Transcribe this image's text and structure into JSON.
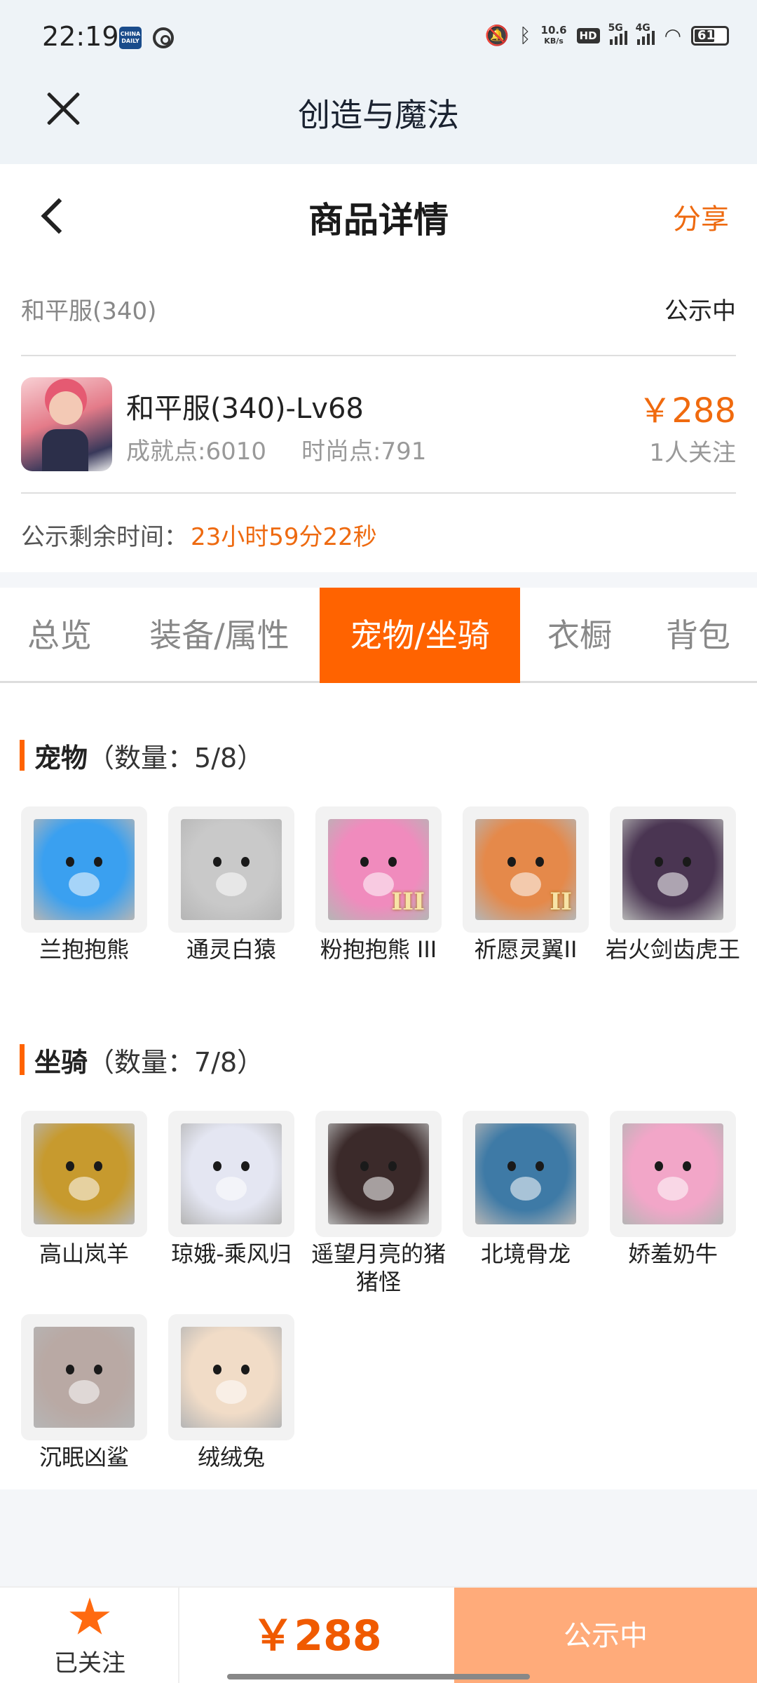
{
  "status_bar": {
    "time": "22:19",
    "speed_top": "10.6",
    "speed_unit": "KB/s",
    "hd_label": "HD",
    "net1": "5G",
    "net2": "4G",
    "battery": "61"
  },
  "app_header": {
    "title": "创造与魔法"
  },
  "nav": {
    "title": "商品详情",
    "share_label": "分享"
  },
  "listing": {
    "server": "和平服(340)",
    "status": "公示中",
    "character_name": "和平服(340)-Lv68",
    "achievement": "成就点:6010",
    "fashion": "时尚点:791",
    "price": "￥288",
    "followers": "1人关注",
    "remaining_label": "公示剩余时间：",
    "remaining_value": "23小时59分22秒"
  },
  "tabs": [
    {
      "label": "总览",
      "active": false
    },
    {
      "label": "装备/属性",
      "active": false
    },
    {
      "label": "宠物/坐骑",
      "active": true
    },
    {
      "label": "衣橱",
      "active": false
    },
    {
      "label": "背包",
      "active": false
    }
  ],
  "pets": {
    "title": "宠物",
    "count": "（数量：5/8）",
    "items": [
      {
        "name": "兰抱抱熊",
        "icon": "blue-bear-pet-icon",
        "color": "#3aa0f0"
      },
      {
        "name": "通灵白猿",
        "icon": "white-ape-pet-icon",
        "color": "#c9c9c9"
      },
      {
        "name": "粉抱抱熊 III",
        "icon": "pink-bear-pet-icon",
        "color": "#f08bbd",
        "badge": "III"
      },
      {
        "name": "祈愿灵翼II",
        "icon": "eagle-pet-icon",
        "color": "#e5894a",
        "badge": "II"
      },
      {
        "name": "岩火剑齿虎王",
        "icon": "sabertooth-pet-icon",
        "color": "#4a3552"
      }
    ]
  },
  "mounts": {
    "title": "坐骑",
    "count": "（数量：7/8）",
    "items": [
      {
        "name": "高山岚羊",
        "icon": "mountain-goat-mount-icon",
        "color": "#c79a2e"
      },
      {
        "name": "琼娥-乘风归",
        "icon": "moon-fairy-mount-icon",
        "color": "#e4e6f2"
      },
      {
        "name": "遥望月亮的猪猪怪",
        "icon": "black-pig-mount-icon",
        "color": "#3b2a2a"
      },
      {
        "name": "北境骨龙",
        "icon": "bone-dragon-mount-icon",
        "color": "#3e7aa6"
      },
      {
        "name": "娇羞奶牛",
        "icon": "shy-cow-mount-icon",
        "color": "#f2a6c8"
      },
      {
        "name": "沉眠凶鲨",
        "icon": "shark-mount-icon",
        "color": "#b9a9a4"
      },
      {
        "name": "绒绒兔",
        "icon": "fluffy-rabbit-mount-icon",
        "color": "#f1dcc7"
      }
    ]
  },
  "bottom_bar": {
    "follow_label": "已关注",
    "price": "￥288",
    "cta_label": "公示中"
  }
}
